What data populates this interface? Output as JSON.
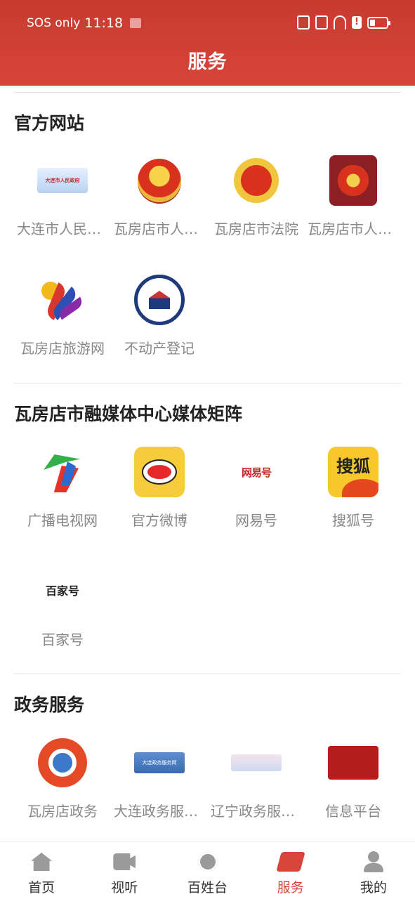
{
  "status_bar": {
    "network": "SOS only",
    "time": "11:18"
  },
  "header": {
    "title": "服务"
  },
  "sections": {
    "official": {
      "title": "官方网站",
      "items": [
        {
          "label": "大连市人民政府",
          "icon": "dalian-gov-banner-icon"
        },
        {
          "label": "瓦房店市人民政府",
          "icon": "national-emblem-icon"
        },
        {
          "label": "瓦房店市法院",
          "icon": "court-emblem-icon"
        },
        {
          "label": "瓦房店市人民检察院",
          "icon": "procuratorate-emblem-icon"
        },
        {
          "label": "瓦房店旅游网",
          "icon": "tourism-logo-icon"
        },
        {
          "label": "不动产登记",
          "icon": "real-estate-registration-icon"
        }
      ]
    },
    "media": {
      "title": "瓦房店市融媒体中心媒体矩阵",
      "items": [
        {
          "label": "广播电视网",
          "icon": "tv-logo-icon"
        },
        {
          "label": "官方微博",
          "icon": "weibo-icon"
        },
        {
          "label": "网易号",
          "icon": "netease-icon"
        },
        {
          "label": "搜狐号",
          "icon": "sohu-icon"
        },
        {
          "label": "百家号",
          "icon": "baijiahao-icon"
        }
      ],
      "netease_logo": "网易号",
      "sohu_logo": "搜狐",
      "baijia_logo": "百家号"
    },
    "gov": {
      "title": "政务服务",
      "items": [
        {
          "label": "瓦房店政务",
          "icon": "wafangdian-gov-icon"
        },
        {
          "label": "大连政务服务网",
          "icon": "dalian-gov-service-icon"
        },
        {
          "label": "辽宁政务服务网",
          "icon": "liaoning-gov-service-icon"
        },
        {
          "label": "信息平台",
          "icon": "info-platform-icon"
        }
      ],
      "dalian_banner": "大连政务服务网"
    }
  },
  "tabbar": [
    {
      "label": "首页",
      "icon": "home-icon"
    },
    {
      "label": "视听",
      "icon": "video-icon"
    },
    {
      "label": "百姓台",
      "icon": "planet-icon"
    },
    {
      "label": "服务",
      "icon": "service-icon",
      "active": true
    },
    {
      "label": "我的",
      "icon": "profile-icon"
    }
  ],
  "colors": {
    "primary": "#d6453a",
    "label_gray": "#888888"
  }
}
